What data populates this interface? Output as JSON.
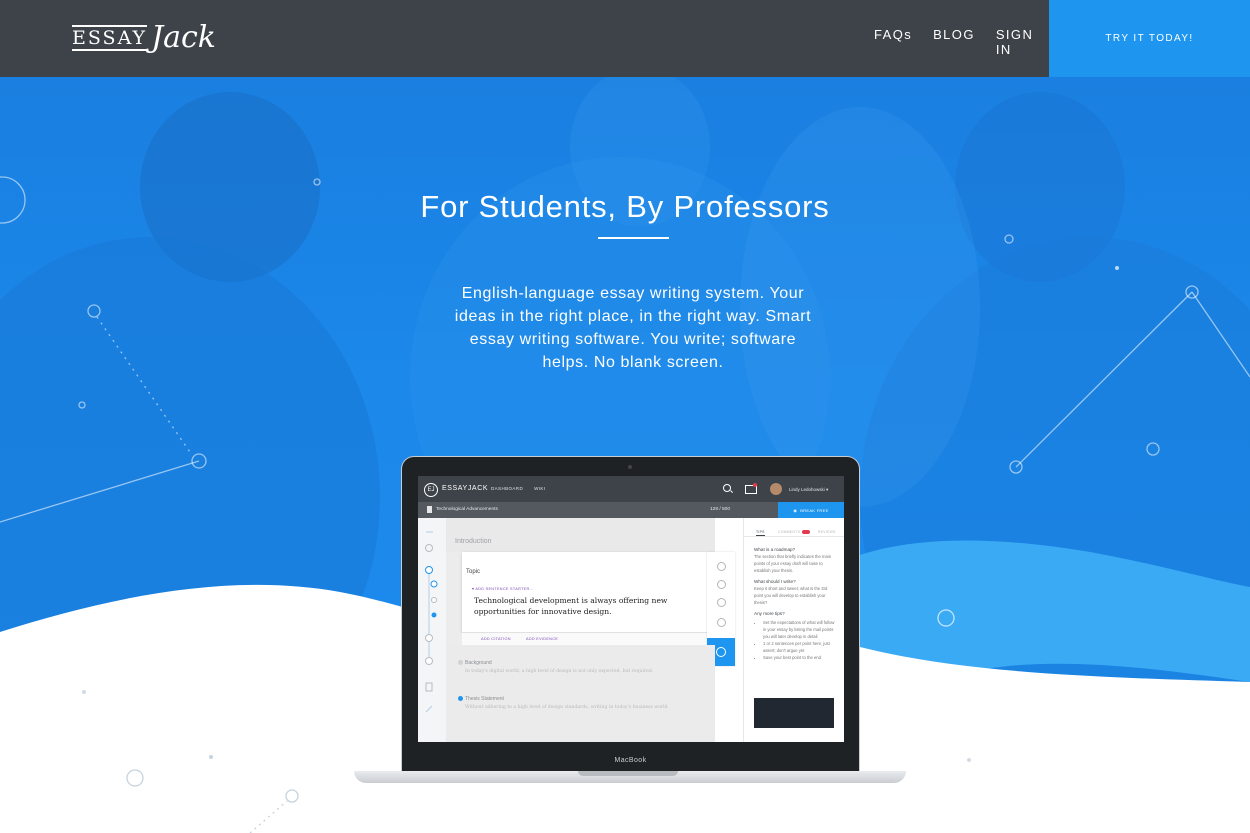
{
  "header": {
    "logo": {
      "word1": "ESSAY",
      "word2": "Jack"
    },
    "nav": [
      "FAQs",
      "BLOG",
      "SIGN IN"
    ],
    "cta_label": "TRY IT TODAY!"
  },
  "hero": {
    "title": "For Students, By Professors",
    "description": "English-language essay writing system. Your ideas in the right place, in the right way. Smart essay writing software. You write; software helps. No blank screen."
  },
  "device": {
    "brand_label": "MacBook",
    "app": {
      "brand": "ESSAYJACK",
      "logo_text": "EJ",
      "nav": [
        "DASHBOARD",
        "WIKI"
      ],
      "user": "Lindy Ledohowski ▾",
      "doc_title": "Technological Advancements",
      "word_count": "128 / 500",
      "mode_button": "BREAK FREE",
      "section_intro": "Introduction",
      "card": {
        "label": "Topic",
        "starter": "ADD SENTENCE STARTER...",
        "text": "Technological development is always offering new opportunities for innovative design.",
        "links": [
          "ADD CITATION",
          "ADD EVIDENCE"
        ]
      },
      "items": [
        {
          "head": "Background",
          "sub": "In today's digital world, a high level of design is not only expected, but required."
        },
        {
          "head": "Thesis Statement",
          "sub": "Without adhering to a high level of design standards, writing in today's business world"
        }
      ],
      "panel": {
        "tabs": [
          "TIPS",
          "COMMENTS",
          "REVIEWS"
        ],
        "tips": [
          {
            "q": "What is a roadmap?",
            "a": "The section that briefly indicates the main points of your essay draft will raise to establish your thesis."
          },
          {
            "q": "What should I write?",
            "a": "Keep it short and sweet; what is the 3rd point you will develop to establish your thesis?"
          },
          {
            "q": "Any more tips?",
            "bullets": [
              "Set the expectations of what will follow in your essay by listing the mail points you will later develop in detail",
              "1 or 2 sentences per point here, just assert; don't argue yet",
              "Save your best point to the end"
            ]
          }
        ]
      }
    }
  },
  "colors": {
    "header_bg": "#3e4349",
    "accent": "#1e95ef",
    "hero_blue": "#1b88ea"
  }
}
